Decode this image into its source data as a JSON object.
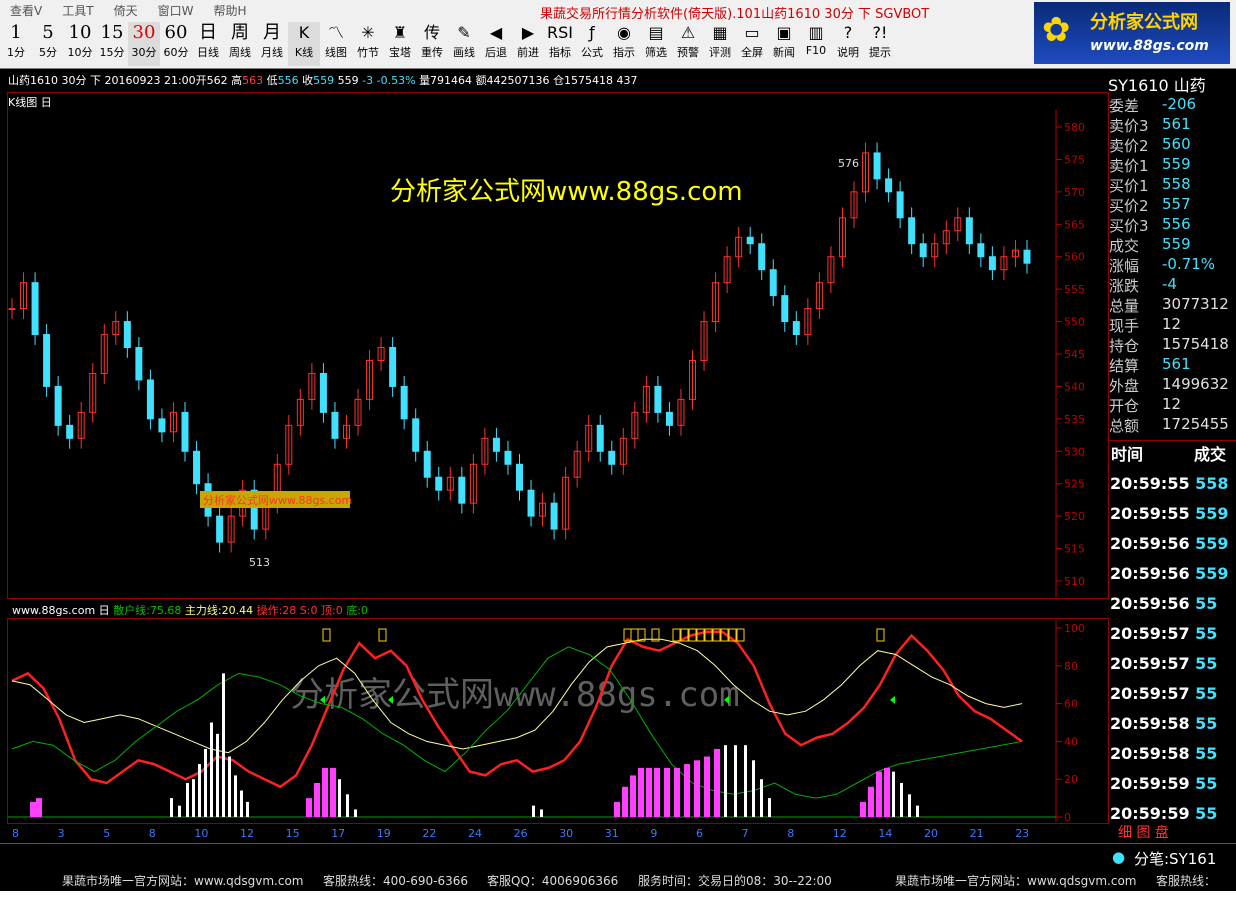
{
  "menu": [
    "查看V",
    "工具T",
    "倚天",
    "窗口W",
    "帮助H"
  ],
  "window_title": "果蔬交易所行情分析软件(倚天版).101山药1610 30分 下 SGVBOT",
  "toolbar": [
    {
      "big": "1",
      "label": "1分"
    },
    {
      "big": "5",
      "label": "5分"
    },
    {
      "big": "10",
      "label": "10分"
    },
    {
      "big": "15",
      "label": "15分"
    },
    {
      "big": "30",
      "label": "30分",
      "active": true
    },
    {
      "big": "60",
      "label": "60分"
    },
    {
      "big": "日",
      "label": "日线"
    },
    {
      "big": "周",
      "label": "周线"
    },
    {
      "big": "月",
      "label": "月线"
    },
    {
      "icon": "K",
      "label": "K线",
      "active": true
    },
    {
      "icon": "〽",
      "label": "线图"
    },
    {
      "icon": "✳",
      "label": "竹节"
    },
    {
      "icon": "♜",
      "label": "宝塔"
    },
    {
      "icon": "传",
      "label": "重传"
    },
    {
      "icon": "✎",
      "label": "画线"
    },
    {
      "icon": "◀",
      "label": "后退"
    },
    {
      "icon": "▶",
      "label": "前进"
    },
    {
      "icon": "RSI",
      "label": "指标"
    },
    {
      "icon": "ƒ",
      "label": "公式"
    },
    {
      "icon": "◉",
      "label": "指示"
    },
    {
      "icon": "▤",
      "label": "筛选"
    },
    {
      "icon": "⚠",
      "label": "预警"
    },
    {
      "icon": "▦",
      "label": "评测"
    },
    {
      "icon": "▭",
      "label": "全屏"
    },
    {
      "icon": "▣",
      "label": "新闻"
    },
    {
      "icon": "▥",
      "label": "F10"
    },
    {
      "icon": "?",
      "label": "说明"
    },
    {
      "icon": "?!",
      "label": "提示"
    }
  ],
  "logo": {
    "title": "分析家公式网",
    "url": "www.88gs.com"
  },
  "info_line": {
    "symbol": "山药1610 30分 下",
    "date": "20160923 21:00",
    "open_label": "开",
    "open": "562",
    "high_label": "高",
    "high": "563",
    "low_label": "低",
    "low": "556",
    "close_label": "收",
    "close": "559",
    "extra": "559",
    "change": "-3",
    "change_pct": "-0.53%",
    "volume": "量791464",
    "amount": "额442507136",
    "oi": "仓1575418 437"
  },
  "kline_label": "K线图 日",
  "watermark": "分析家公式网www.88gs.com",
  "small_watermark": "分析家公式网www.88gs.com",
  "indicator_line": {
    "name": "www.88gs.com 日",
    "retail": "散户线:75.68",
    "main": "主力线:20.44",
    "op": "操作:28",
    "s": "S:0",
    "top": "顶:0",
    "bottom": "底:0"
  },
  "big_watermark": "分析家公式网www.88gs.com",
  "price_axis": [
    "580",
    "575",
    "570",
    "565",
    "560",
    "555",
    "550",
    "545",
    "540",
    "535",
    "530",
    "525",
    "520",
    "515",
    "510"
  ],
  "ind_axis": [
    "100",
    "80",
    "60",
    "40",
    "20",
    "0"
  ],
  "date_axis": [
    "8",
    "3",
    "5",
    "8",
    "10",
    "12",
    "15",
    "17",
    "19",
    "22",
    "24",
    "26",
    "30",
    "31",
    "9",
    "6",
    "7",
    "8",
    "12",
    "14",
    "20",
    "21",
    "23"
  ],
  "hi_label": "576",
  "lo_label": "513",
  "right_panel": {
    "title": "SY1610 山药",
    "quotes": [
      {
        "label": "委差",
        "value": "-206",
        "color": "#40e0ff"
      },
      {
        "label": "卖价3",
        "value": "561",
        "color": "#40e0ff"
      },
      {
        "label": "卖价2",
        "value": "560",
        "color": "#40e0ff"
      },
      {
        "label": "卖价1",
        "value": "559",
        "color": "#40e0ff"
      },
      {
        "label": "买价1",
        "value": "558",
        "color": "#40e0ff"
      },
      {
        "label": "买价2",
        "value": "557",
        "color": "#40e0ff"
      },
      {
        "label": "买价3",
        "value": "556",
        "color": "#40e0ff"
      },
      {
        "label": "成交",
        "value": "559",
        "color": "#40e0ff"
      },
      {
        "label": "涨幅",
        "value": "-0.71%",
        "color": "#40e0ff"
      },
      {
        "label": "涨跌",
        "value": "-4",
        "color": "#40e0ff"
      },
      {
        "label": "总量",
        "value": "3077312",
        "color": "#e0e0e0"
      },
      {
        "label": "现手",
        "value": "12",
        "color": "#e0e0e0"
      },
      {
        "label": "持仓",
        "value": "1575418",
        "color": "#e0e0e0"
      },
      {
        "label": "结算",
        "value": "561",
        "color": "#40e0ff"
      },
      {
        "label": "外盘",
        "value": "1499632",
        "color": "#e0e0e0"
      },
      {
        "label": "开仓",
        "value": "12",
        "color": "#e0e0e0"
      },
      {
        "label": "总额",
        "value": "1725455",
        "color": "#e0e0e0"
      }
    ],
    "trade_header": {
      "time": "时间",
      "vol": "成交"
    },
    "trades": [
      {
        "time": "20:59:55",
        "v": "558"
      },
      {
        "time": "20:59:55",
        "v": "559"
      },
      {
        "time": "20:59:56",
        "v": "559"
      },
      {
        "time": "20:59:56",
        "v": "559"
      },
      {
        "time": "20:59:56",
        "v": "55"
      },
      {
        "time": "20:59:57",
        "v": "55"
      },
      {
        "time": "20:59:57",
        "v": "55"
      },
      {
        "time": "20:59:57",
        "v": "55"
      },
      {
        "time": "20:59:58",
        "v": "55"
      },
      {
        "time": "20:59:58",
        "v": "55"
      },
      {
        "time": "20:59:59",
        "v": "55"
      },
      {
        "time": "20:59:59",
        "v": "55"
      }
    ],
    "tabs": [
      "细",
      "图",
      "盘"
    ],
    "fen_label": "分笔:SY161"
  },
  "footer": {
    "site": "果蔬市场唯一官方网站：www.qdsgvm.com",
    "hotline": "客服热线：400-690-6366",
    "qq": "客服QQ：4006906366",
    "hours": "服务时间：交易日的08：30--22:00",
    "site2": "果蔬市场唯一官方网站：www.qdsgvm.com",
    "hotline2": "客服热线："
  }
}
